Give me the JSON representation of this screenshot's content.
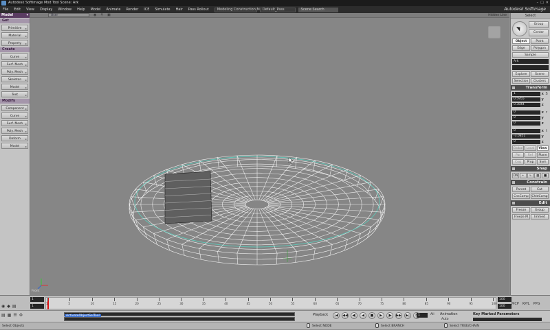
{
  "window": {
    "title": "Autodesk Softimage Mod Tool Scene: Ark",
    "brand": "Autodesk Softimage"
  },
  "menu": {
    "items": [
      "File",
      "Edit",
      "View",
      "Display",
      "Window",
      "Help",
      "Model",
      "Animate",
      "Render",
      "ICE",
      "Simulate",
      "Hair",
      "Pass Rollout"
    ],
    "mode_value": "Modeling Construction Mode",
    "pass_value": "Default_Pass",
    "scene_search_placeholder": "Scene Search"
  },
  "left_panel": {
    "module": "Model",
    "sections": [
      {
        "title": "Get",
        "buttons": [
          "Primitive",
          "Material",
          "Property"
        ]
      },
      {
        "title": "Create",
        "buttons": [
          "Curve",
          "Surf. Mesh",
          "Poly. Mesh",
          "Skeleton",
          "Model",
          "Text"
        ]
      },
      {
        "title": "Modify",
        "buttons": [
          "Component",
          "Curve",
          "Surf. Mesh",
          "Poly. Mesh",
          "Deform",
          "Model"
        ]
      }
    ]
  },
  "viewport": {
    "camera": "User",
    "display_mode": "Hidden Line",
    "label": "Front"
  },
  "right_panel": {
    "title": "Select",
    "tool_buttons": [
      "Group",
      "Center"
    ],
    "filter_row1": [
      "Object",
      "Point"
    ],
    "filter_row2": [
      "Edge",
      "Polygon"
    ],
    "sample": "Sample",
    "selected_name": "Ark",
    "explore_row": [
      "Explore",
      "Scene"
    ],
    "selection_row": [
      "Selection",
      "Clusters"
    ],
    "transform_title": "Transform",
    "scale": [
      "1",
      "0.5955",
      "0.3844"
    ],
    "rotate": [
      "0",
      "0",
      "0"
    ],
    "translate": [
      "0",
      "-3.0851",
      "0"
    ],
    "scale_labels": [
      "x",
      "y",
      "z"
    ],
    "ref_row": [
      "Global",
      "Local",
      "View"
    ],
    "ref_row2": [
      "Par",
      "Ref",
      "Plane"
    ],
    "ref_row3": [
      "Cog",
      "Prop",
      "Sym"
    ],
    "snap_title": "Snap",
    "snap_on": "ON",
    "constrain_title": "Constrain",
    "constrain_row1": [
      "Parent",
      "Cut"
    ],
    "constrain_row2": [
      "CnsComp",
      "ChldComp"
    ],
    "edit_title": "Edit",
    "edit_row1": [
      "Freeze",
      "Group"
    ],
    "edit_row2": [
      "Freeze M",
      "Immed"
    ]
  },
  "timeline": {
    "start": "1",
    "end": "100",
    "start2": "1",
    "end2": "100",
    "ticks": [
      "1",
      "5",
      "10",
      "15",
      "20",
      "25",
      "30",
      "35",
      "40",
      "45",
      "50",
      "55",
      "60",
      "65",
      "70",
      "75",
      "80",
      "85",
      "90",
      "95",
      "100"
    ],
    "right_icons": [
      "KP/L",
      "PPG"
    ],
    "playhead_frame": 1
  },
  "command_bar": {
    "command_text": "ActivateObjectSelTool",
    "playback_label": "Playback",
    "controls": [
      "|◀",
      "◀◀",
      "◀|",
      "◀",
      "■",
      "▶",
      "|▶",
      "▶▶",
      "▶|",
      "↻"
    ],
    "frame": "1",
    "all": "All",
    "animation_label": "Animation",
    "auto_label": "Auto",
    "kmp_label": "Key Marked Parameters"
  },
  "status_bar": {
    "left": "Select Objects",
    "m1": "Select NODE",
    "m2": "Select BRANCH",
    "m3": "Select TREE/CHAIN"
  }
}
